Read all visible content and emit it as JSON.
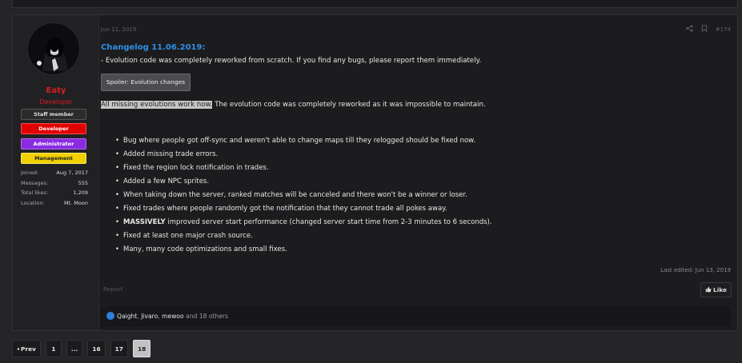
{
  "post": {
    "user": {
      "name": "Eaty",
      "title": "Developer",
      "banners": [
        "Staff member",
        "Developer",
        "Administrator",
        "Management"
      ],
      "stats": [
        {
          "label": "Joined:",
          "value": "Aug 7, 2017"
        },
        {
          "label": "Messages:",
          "value": "555"
        },
        {
          "label": "Total likes:",
          "value": "1,209"
        },
        {
          "label": "Location:",
          "value": "Mt. Moon"
        }
      ]
    },
    "date": "Jun 11, 2019",
    "post_number": "#174",
    "changelog_title": "Changelog 11.06.2019:",
    "intro": "- Evolution code was completely reworked from scratch. If you find any bugs, please report them immediately.",
    "spoiler_label": "Spoiler: Evolution changes",
    "summary_highlight": "All missing evolutions work now.",
    "summary_rest": " The evolution code was completely reworked as it was impossible to maintain.",
    "bullets": [
      {
        "bold": "",
        "text": "Bug where people got off-sync and weren't able to change maps till they relogged should be fixed now."
      },
      {
        "bold": "",
        "text": "Added missing trade errors."
      },
      {
        "bold": "",
        "text": "Fixed the region lock notification in trades."
      },
      {
        "bold": "",
        "text": "Added a few NPC sprites."
      },
      {
        "bold": "",
        "text": "When taking down the server, ranked matches will be canceled and there won't be a winner or loser."
      },
      {
        "bold": "",
        "text": "Fixed trades where people randomly got the notification that they cannot trade all pokes away."
      },
      {
        "bold": "MASSIVELY",
        "text": " improved server start performance (changed server start time from 2-3 minutes to 6 seconds)."
      },
      {
        "bold": "",
        "text": "Fixed at least one major crash source."
      },
      {
        "bold": "",
        "text": "Many, many code optimizations and small fixes."
      }
    ],
    "last_edited": "Last edited: Jun 13, 2019",
    "report_label": "Report",
    "like_label": "Like",
    "reactions": {
      "names": [
        "Qaight",
        "Jivaro",
        "mewoo"
      ],
      "others": "and 18 others"
    }
  },
  "pagination": {
    "prev_label": "Prev",
    "pages": [
      "1",
      "...",
      "16",
      "17",
      "18"
    ],
    "current": "18"
  }
}
